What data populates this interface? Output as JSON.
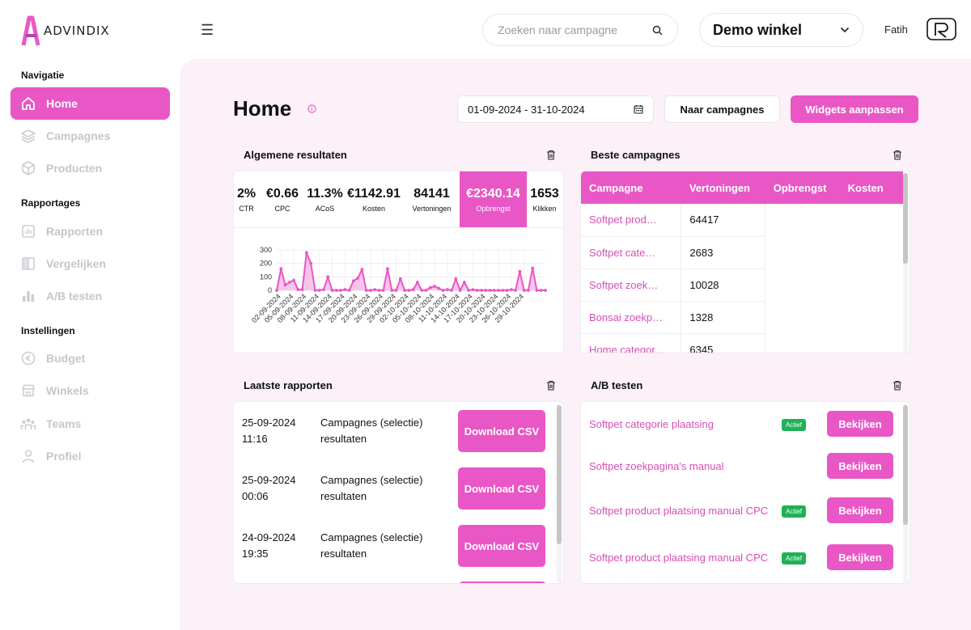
{
  "brand": {
    "name": "ADVINDIX",
    "accent": "#e957c6"
  },
  "sidebar": {
    "sections": [
      {
        "title": "Navigatie",
        "items": [
          {
            "label": "Home",
            "icon": "home-icon",
            "active": true
          },
          {
            "label": "Campagnes",
            "icon": "layers-icon"
          },
          {
            "label": "Producten",
            "icon": "box-icon"
          }
        ]
      },
      {
        "title": "Rapportages",
        "items": [
          {
            "label": "Rapporten",
            "icon": "report-icon"
          },
          {
            "label": "Vergelijken",
            "icon": "compare-icon"
          },
          {
            "label": "A/B testen",
            "icon": "bar-chart-icon"
          }
        ]
      },
      {
        "title": "Instellingen",
        "items": [
          {
            "label": "Budget",
            "icon": "euro-icon"
          },
          {
            "label": "Winkels",
            "icon": "store-icon"
          },
          {
            "label": "Teams",
            "icon": "team-icon"
          },
          {
            "label": "Profiel",
            "icon": "user-icon"
          }
        ]
      }
    ]
  },
  "topbar": {
    "search_placeholder": "Zoeken naar campagne",
    "store": "Demo winkel",
    "user": "Fatih"
  },
  "page": {
    "title": "Home",
    "date_range": "01-09-2024 - 31-10-2024",
    "to_campaigns": "Naar campagnes",
    "customize_widgets": "Widgets aanpassen"
  },
  "general": {
    "title": "Algemene resultaten",
    "stats": [
      {
        "value": "2%",
        "label": "CTR"
      },
      {
        "value": "€0.66",
        "label": "CPC"
      },
      {
        "value": "11.3%",
        "label": "ACoS"
      },
      {
        "value": "€1142.91",
        "label": "Kosten"
      },
      {
        "value": "84141",
        "label": "Vertoningen"
      },
      {
        "value": "€2340.14",
        "label": "Opbrengst",
        "highlight": true
      },
      {
        "value": "1653",
        "label": "Klikken"
      }
    ]
  },
  "chart_data": {
    "type": "area",
    "yticks": [
      0,
      100,
      200,
      300
    ],
    "ylim": [
      0,
      300
    ],
    "x": [
      "01-09-2024",
      "02-09-2024",
      "03-09-2024",
      "04-09-2024",
      "05-09-2024",
      "06-09-2024",
      "07-09-2024",
      "08-09-2024",
      "09-09-2024",
      "10-09-2024",
      "11-09-2024",
      "12-09-2024",
      "13-09-2024",
      "14-09-2024",
      "15-09-2024",
      "16-09-2024",
      "17-09-2024",
      "18-09-2024",
      "19-09-2024",
      "20-09-2024",
      "21-09-2024",
      "22-09-2024",
      "23-09-2024",
      "24-09-2024",
      "25-09-2024",
      "26-09-2024",
      "27-09-2024",
      "28-09-2024",
      "29-09-2024",
      "30-09-2024",
      "01-10-2024",
      "02-10-2024",
      "03-10-2024",
      "04-10-2024",
      "05-10-2024",
      "06-10-2024",
      "07-10-2024",
      "08-10-2024",
      "09-10-2024",
      "10-10-2024",
      "11-10-2024",
      "12-10-2024",
      "13-10-2024",
      "14-10-2024",
      "15-10-2024",
      "16-10-2024",
      "17-10-2024",
      "18-10-2024",
      "19-10-2024",
      "20-10-2024",
      "21-10-2024",
      "22-10-2024",
      "23-10-2024",
      "24-10-2024",
      "25-10-2024",
      "26-10-2024",
      "27-10-2024",
      "28-10-2024",
      "29-10-2024",
      "30-10-2024",
      "31-10-2024"
    ],
    "xtick_labels": [
      "02-09-2024",
      "05-09-2024",
      "08-09-2024",
      "11-09-2024",
      "14-09-2024",
      "17-09-2024",
      "20-09-2024",
      "23-09-2024",
      "26-09-2024",
      "29-09-2024",
      "02-10-2024",
      "05-10-2024",
      "08-10-2024",
      "11-10-2024",
      "14-10-2024",
      "17-10-2024",
      "20-10-2024",
      "23-10-2024",
      "26-10-2024",
      "29-10-2024"
    ],
    "values": [
      0,
      160,
      40,
      60,
      75,
      5,
      5,
      280,
      200,
      0,
      0,
      5,
      100,
      0,
      0,
      0,
      5,
      0,
      70,
      90,
      155,
      0,
      0,
      5,
      0,
      0,
      160,
      0,
      0,
      85,
      0,
      0,
      5,
      60,
      0,
      0,
      20,
      30,
      15,
      0,
      5,
      0,
      85,
      0,
      60,
      0,
      5,
      0,
      0,
      0,
      0,
      0,
      0,
      0,
      0,
      5,
      0,
      140,
      0,
      0,
      165,
      0,
      0,
      0
    ]
  },
  "campaigns": {
    "title": "Beste campagnes",
    "headers": [
      "Campagne",
      "Vertoningen",
      "Opbrengst",
      "Kosten"
    ],
    "rows": [
      {
        "name": "Softpet prod…",
        "impressions": "64417"
      },
      {
        "name": "Softpet cate…",
        "impressions": "2683"
      },
      {
        "name": "Softpet zoek…",
        "impressions": "10028"
      },
      {
        "name": "Bonsai zoekp…",
        "impressions": "1328"
      },
      {
        "name": "Home categor…",
        "impressions": "6345"
      }
    ]
  },
  "reports": {
    "title": "Laatste rapporten",
    "download_label": "Download CSV",
    "items": [
      {
        "date": "25-09-2024",
        "time": "11:16",
        "desc": "Campagnes (selectie) resultaten"
      },
      {
        "date": "25-09-2024",
        "time": "00:06",
        "desc": "Campagnes (selectie) resultaten"
      },
      {
        "date": "24-09-2024",
        "time": "19:35",
        "desc": "Campagnes (selectie) resultaten"
      }
    ]
  },
  "ab": {
    "title": "A/B testen",
    "button_label": "Bekijken",
    "badge": "Actief",
    "items": [
      {
        "name": "Softpet categorie plaatsing",
        "active": true
      },
      {
        "name": "Softpet zoekpagina's manual",
        "active": false
      },
      {
        "name": "Softpet product plaatsing manual CPC",
        "active": true
      },
      {
        "name": "Softpet product plaatsing manual CPC",
        "active": true
      }
    ]
  }
}
